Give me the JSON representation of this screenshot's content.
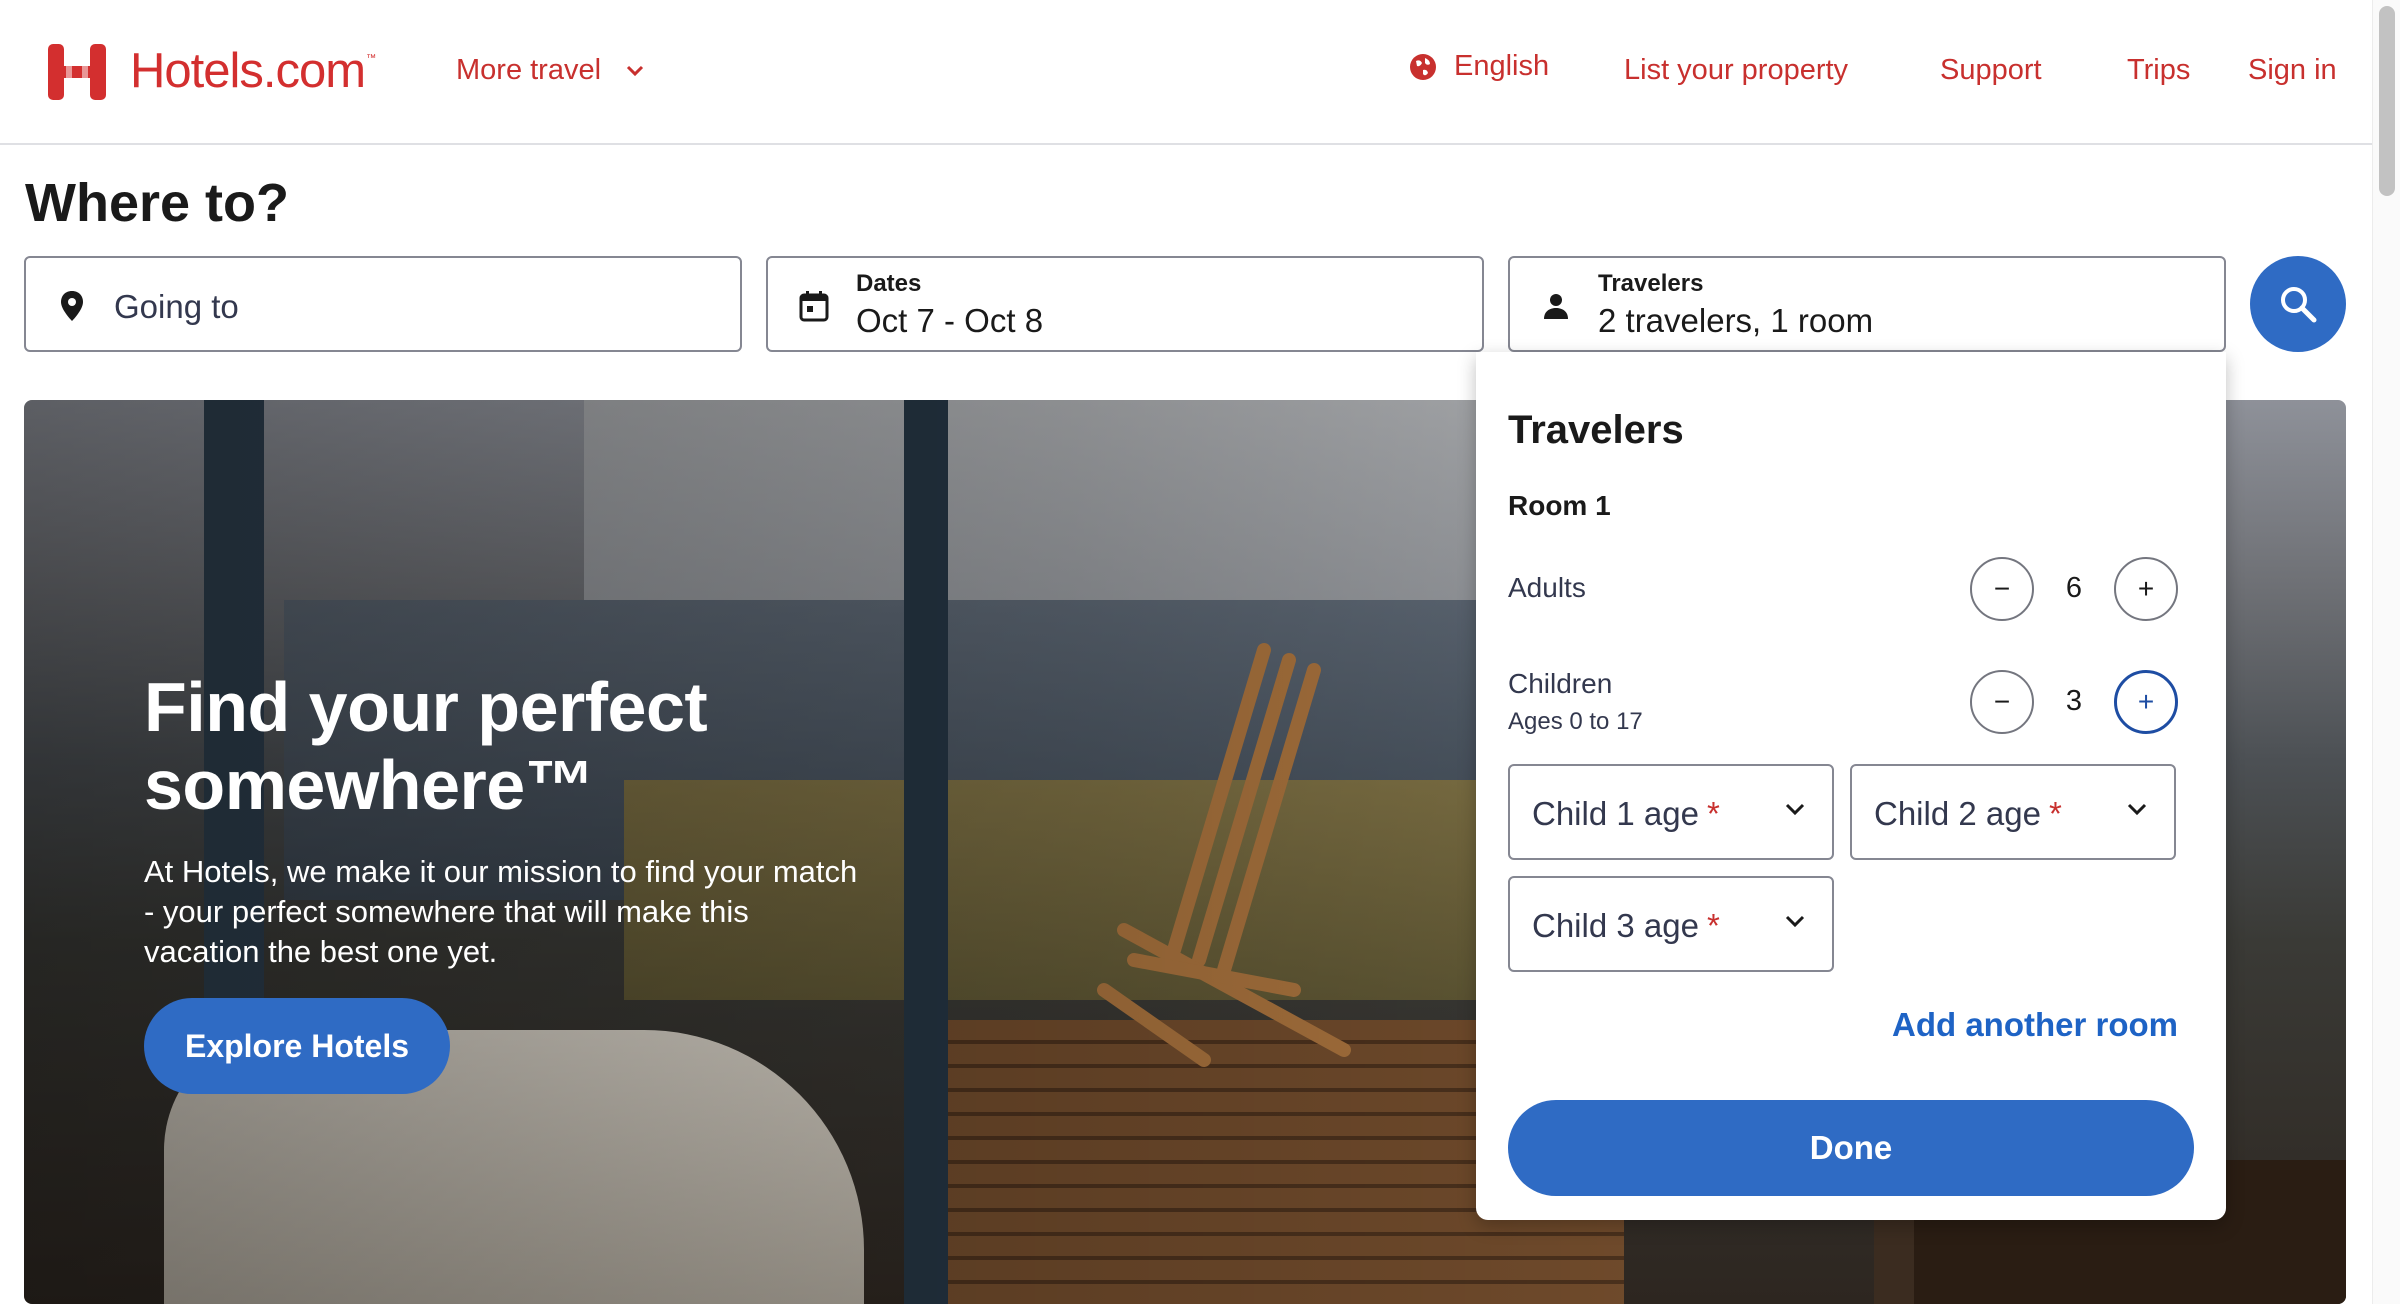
{
  "header": {
    "logo_text": "Hotels.com",
    "logo_tm": "™",
    "more_travel": "More travel",
    "language": "English",
    "list_property": "List your property",
    "support": "Support",
    "trips": "Trips",
    "sign_in": "Sign in"
  },
  "search": {
    "title": "Where to?",
    "going_to_placeholder": "Going to",
    "dates_label": "Dates",
    "dates_value": "Oct 7 - Oct 8",
    "travelers_label": "Travelers",
    "travelers_value": "2 travelers, 1 room"
  },
  "hero": {
    "title": "Find your perfect somewhere™",
    "text": "At Hotels, we make it our mission to find your match - your perfect somewhere that will make this vacation the best one yet.",
    "button": "Explore Hotels"
  },
  "travelers_popover": {
    "title": "Travelers",
    "room_label": "Room 1",
    "adults_label": "Adults",
    "adults_count": "6",
    "children_label": "Children",
    "children_sub": "Ages 0 to 17",
    "children_count": "3",
    "minus": "−",
    "plus": "+",
    "child_ages": [
      {
        "label": "Child 1 age",
        "required": "*"
      },
      {
        "label": "Child 2 age",
        "required": "*"
      },
      {
        "label": "Child 3 age",
        "required": "*"
      }
    ],
    "add_room": "Add another room",
    "done": "Done"
  },
  "colors": {
    "brand_red": "#d32f2f",
    "primary_blue": "#2f6bc4",
    "link_blue": "#1e63c5"
  },
  "icons": [
    "hotels-logo-icon",
    "chevron-down-icon",
    "globe-icon",
    "location-pin-icon",
    "calendar-icon",
    "person-icon",
    "search-icon"
  ]
}
